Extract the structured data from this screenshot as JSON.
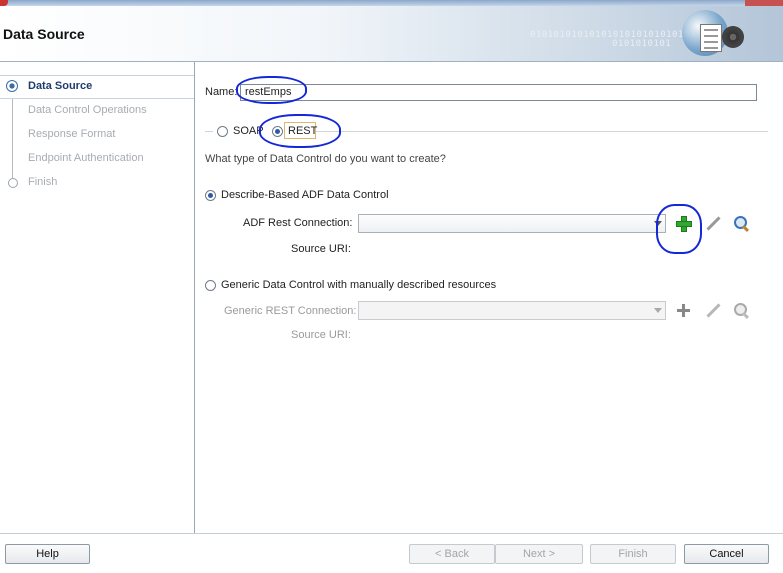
{
  "header": {
    "title": "Data Source"
  },
  "steps": [
    {
      "label": "Data Source"
    },
    {
      "label": "Data Control Operations"
    },
    {
      "label": "Response Format"
    },
    {
      "label": "Endpoint Authentication"
    },
    {
      "label": "Finish"
    }
  ],
  "form": {
    "name_label": "Name:",
    "name_value": "restEmps",
    "soap_label": "SOAP",
    "rest_label": "REST",
    "question": "What type of Data Control do you want to create?",
    "describe_option": "Describe-Based ADF Data Control",
    "adf_rest_conn_label": "ADF Rest Connection:",
    "source_uri_label": "Source URI:",
    "generic_option": "Generic Data Control with manually described resources",
    "generic_rest_conn_label": "Generic REST Connection:",
    "source_uri_label_2": "Source URI:"
  },
  "footer": {
    "help": "Help",
    "back": "< Back",
    "next": "Next >",
    "finish": "Finish",
    "cancel": "Cancel"
  },
  "colors": {
    "accent": "#1f3c6e",
    "annotation": "#1428d8",
    "add_green": "#2fa82f"
  }
}
